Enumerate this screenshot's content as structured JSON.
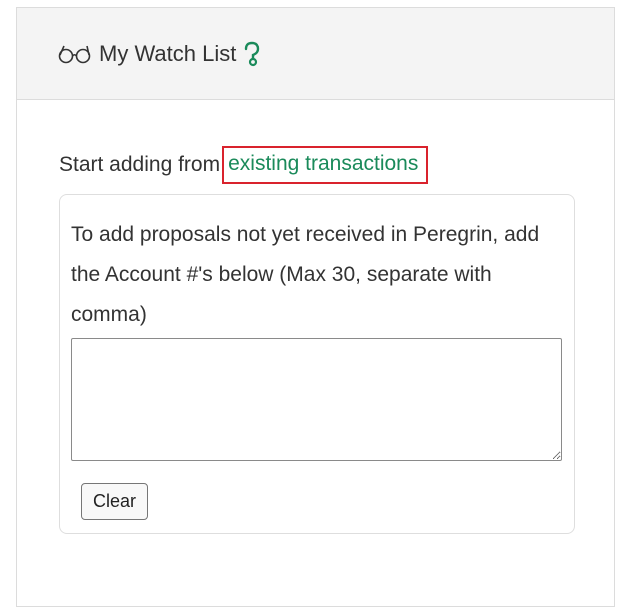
{
  "header": {
    "title": "My Watch List",
    "title_icon": "glasses-icon",
    "help_icon": "question-mark-icon",
    "accent_color": "#1a8a5a"
  },
  "body": {
    "start_text": "Start adding from",
    "existing_link_label": "existing transactions",
    "highlight_color": "#d9232d"
  },
  "card": {
    "instructions": "To add proposals not yet received in Peregrin, add the Account #'s below (Max 30, separate with comma)",
    "textarea_value": "",
    "clear_label": "Clear"
  }
}
